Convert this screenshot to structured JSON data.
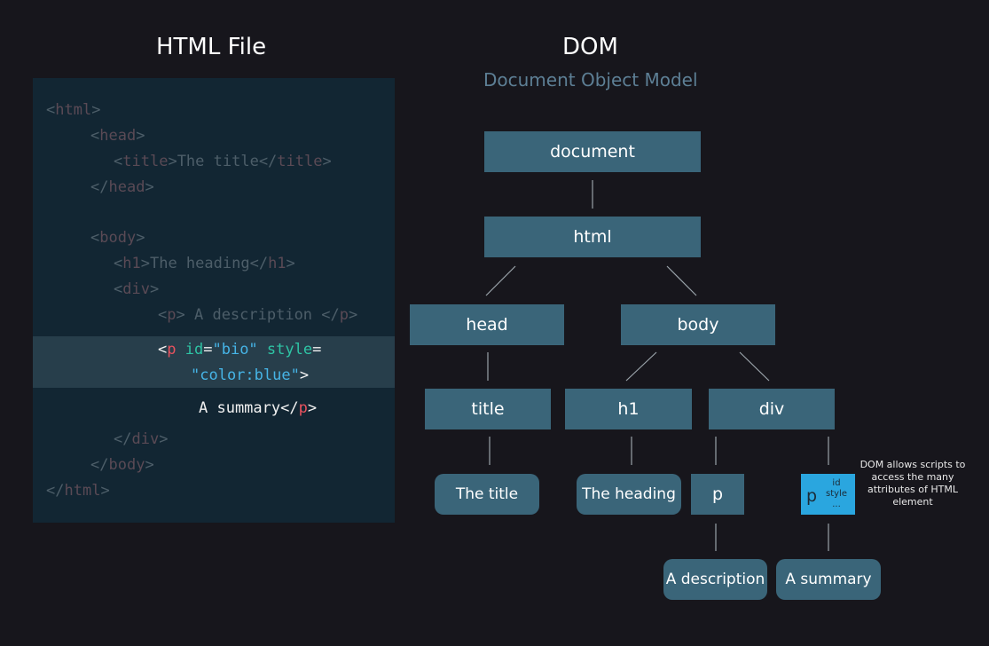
{
  "left_title": "HTML File",
  "right_title": "DOM",
  "right_subtitle": "Document Object Model",
  "code": {
    "l1": {
      "o": "<",
      "tag": "html",
      "c": ">"
    },
    "l2": {
      "o": "<",
      "tag": "head",
      "c": ">"
    },
    "l3": {
      "o": "<",
      "tag": "title",
      "c": ">",
      "text": "The title",
      "o2": "</",
      "tag2": "title",
      "c2": ">"
    },
    "l4": {
      "o": "</",
      "tag": "head",
      "c": ">"
    },
    "l5": {
      "o": "<",
      "tag": "body",
      "c": ">"
    },
    "l6": {
      "o": "<",
      "tag": "h1",
      "c": ">",
      "text": "The heading",
      "o2": "</",
      "tag2": "h1",
      "c2": ">"
    },
    "l7": {
      "o": "<",
      "tag": "div",
      "c": ">"
    },
    "l8": {
      "o": "<",
      "tag": "p",
      "c": ">",
      "text": " A description ",
      "o2": "</",
      "tag2": "p",
      "c2": ">"
    },
    "l9": {
      "o": "<",
      "tag": "p",
      "attr1": "id",
      "eq1": "=",
      "val1": "\"bio\"",
      "attr2": "style",
      "eq2": "="
    },
    "l10": {
      "val2": "\"color:blue\"",
      "c": ">"
    },
    "l11": {
      "text": "A summary",
      "o2": "</",
      "tag2": "p",
      "c2": ">"
    },
    "l12": {
      "o": "</",
      "tag": "div",
      "c": ">"
    },
    "l13": {
      "o": "</",
      "tag": "body",
      "c": ">"
    },
    "l14": {
      "o": "</",
      "tag": "html",
      "c": ">"
    }
  },
  "dom": {
    "document": "document",
    "html": "html",
    "head": "head",
    "body": "body",
    "title": "title",
    "h1": "h1",
    "div": "div",
    "title_text": "The title",
    "heading_text": "The heading",
    "p_desc": "p",
    "p_bio": "p",
    "p_bio_attr1": "id",
    "p_bio_attr2": "style",
    "p_bio_attr3": "...",
    "desc_text": "A description",
    "summary_text": "A summary"
  },
  "note": "DOM allows scripts to access the many attributes of HTML element",
  "colors": {
    "background": "#17161c",
    "panel": "#122633",
    "highlight": "#273e4b",
    "node": "#3a6579",
    "attr_node": "#2aa6df",
    "tag_red": "#e8525e",
    "attr_green": "#2ec4a5",
    "value_blue": "#46b4e6"
  }
}
